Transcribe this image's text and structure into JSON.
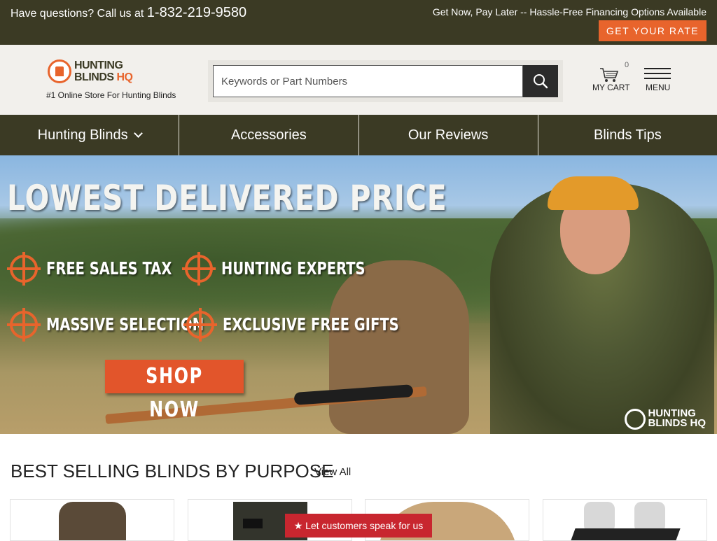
{
  "topbar": {
    "phone_prefix": "Have questions? Call us at ",
    "phone_number": "1-832-219-9580",
    "financing": "Get Now, Pay Later -- Hassle-Free Financing Options Available",
    "rate_button": "GET YOUR RATE"
  },
  "header": {
    "logo_line1": "HUNTING",
    "logo_line2a": "BLINDS ",
    "logo_line2b": "HQ",
    "tagline": "#1 Online Store For Hunting Blinds",
    "search_placeholder": "Keywords or Part Numbers",
    "cart_label": "MY CART",
    "cart_count": "0",
    "menu_label": "MENU"
  },
  "nav": {
    "items": [
      {
        "label": "Hunting Blinds"
      },
      {
        "label": "Accessories"
      },
      {
        "label": "Our Reviews"
      },
      {
        "label": "Blinds Tips"
      }
    ]
  },
  "hero": {
    "title": "LOWEST DELIVERED PRICE",
    "features": [
      "FREE SALES TAX",
      "HUNTING EXPERTS",
      "MASSIVE SELECTION",
      "EXCLUSIVE FREE GIFTS"
    ],
    "cta": "SHOP NOW",
    "watermark_line1": "HUNTING",
    "watermark_line2": "BLINDS HQ"
  },
  "best_selling": {
    "title": "BEST SELLING BLINDS BY PURPOSE",
    "view_all": "View All"
  },
  "review_badge": "★ Let customers speak for us",
  "colors": {
    "brand_dark": "#3b3a24",
    "accent_orange": "#e8642c",
    "badge_red": "#c8262f"
  }
}
